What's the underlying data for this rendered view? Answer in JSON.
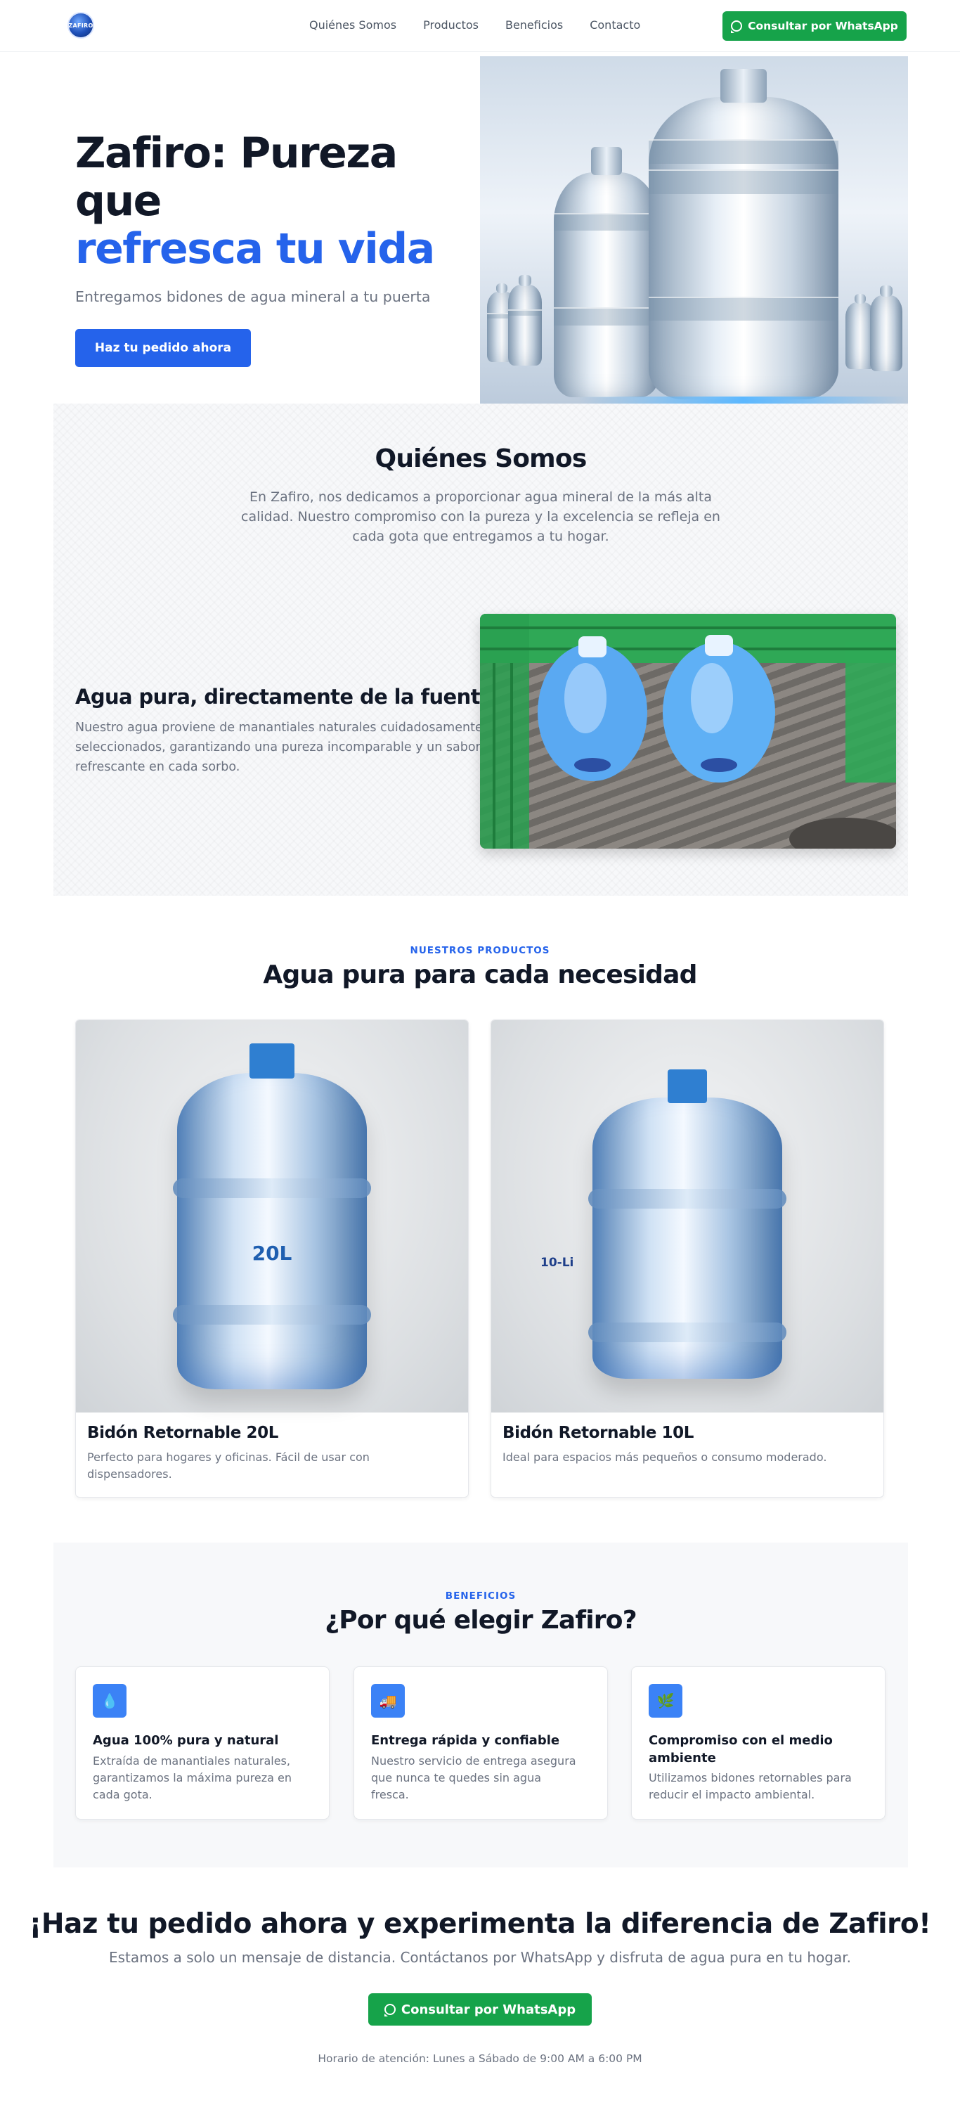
{
  "header": {
    "logo_text": "ZAFIRO",
    "nav": [
      "Quiénes Somos",
      "Productos",
      "Beneficios",
      "Contacto"
    ],
    "cta_label": "Consultar por WhatsApp"
  },
  "hero": {
    "title_line1": "Zafiro: Pureza que",
    "title_line2": "refresca tu vida",
    "subtitle": "Entregamos bidones de agua mineral a tu puerta",
    "button_label": "Haz tu pedido ahora"
  },
  "about": {
    "title": "Quiénes Somos",
    "text": "En Zafiro, nos dedicamos a proporcionar agua mineral de la más alta calidad. Nuestro compromiso con la pureza y la excelencia se refleja en cada gota que entregamos a tu hogar.",
    "sub_title": "Agua pura, directamente de la fuente",
    "sub_text": "Nuestro agua proviene de manantiales naturales cuidadosamente seleccionados, garantizando una pureza incomparable y un sabor refrescante en cada sorbo."
  },
  "products": {
    "eyebrow": "NUESTROS PRODUCTOS",
    "title": "Agua pura para cada necesidad",
    "items": [
      {
        "name": "Bidón Retornable 20L",
        "desc": "Perfecto para hogares y oficinas. Fácil de usar con dispensadores.",
        "img_label": "20L"
      },
      {
        "name": "Bidón Retornable 10L",
        "desc": "Ideal para espacios más pequeños o consumo moderado.",
        "img_label": "10-Li"
      }
    ]
  },
  "benefits": {
    "eyebrow": "BENEFICIOS",
    "title": "¿Por qué elegir Zafiro?",
    "items": [
      {
        "icon": "water-drop-icon",
        "glyph": "💧",
        "title": "Agua 100% pura y natural",
        "desc": "Extraída de manantiales naturales, garantizamos la máxima pureza en cada gota."
      },
      {
        "icon": "truck-icon",
        "glyph": "🚚",
        "title": "Entrega rápida y confiable",
        "desc": "Nuestro servicio de entrega asegura que nunca te quedes sin agua fresca."
      },
      {
        "icon": "leaf-icon",
        "glyph": "🌿",
        "title": "Compromiso con el medio ambiente",
        "desc": "Utilizamos bidones retornables para reducir el impacto ambiental."
      }
    ]
  },
  "cta": {
    "title": "¡Haz tu pedido ahora y experimenta la diferencia de Zafiro!",
    "subtitle": "Estamos a solo un mensaje de distancia. Contáctanos por WhatsApp y disfruta de agua pura en tu hogar.",
    "button_label": "Consultar por WhatsApp",
    "hours": "Horario de atención: Lunes a Sábado de 9:00 AM a 6:00 PM"
  },
  "colors": {
    "primary": "#2563eb",
    "whatsapp": "#16a34a",
    "text": "#111827",
    "muted": "#6b7280"
  }
}
